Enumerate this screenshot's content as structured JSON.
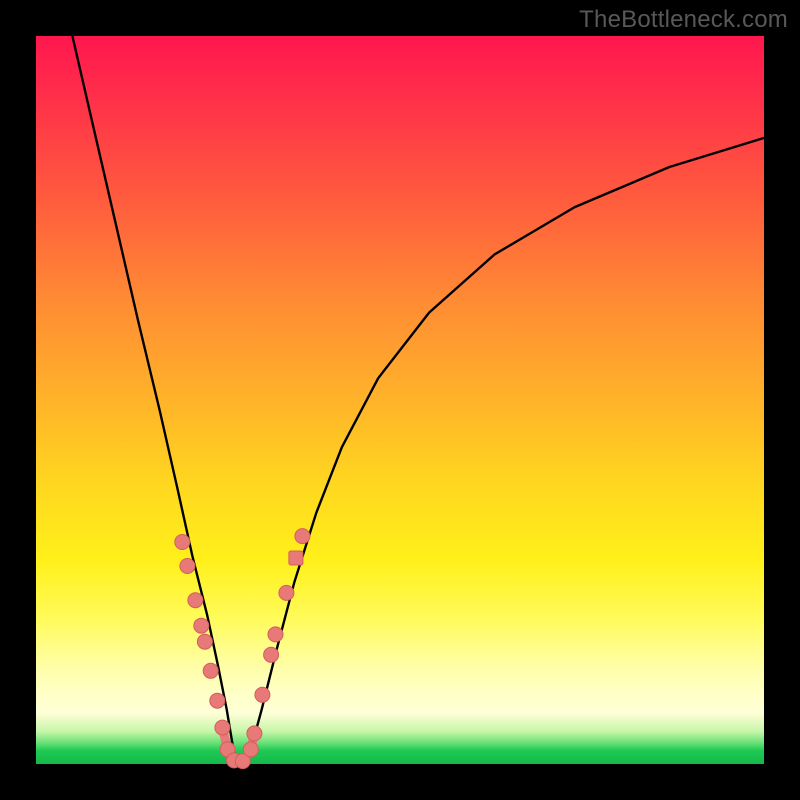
{
  "watermark": "TheBottleneck.com",
  "colors": {
    "dot_fill": "#e77a78",
    "dot_stroke": "#d45d5b",
    "curve": "#000000",
    "frame": "#000000"
  },
  "chart_data": {
    "type": "line",
    "title": "",
    "xlabel": "",
    "ylabel": "",
    "xlim": [
      0,
      1
    ],
    "ylim": [
      0,
      1
    ],
    "series": [
      {
        "name": "bottleneck-curve",
        "note": "V-shaped curve; minimum near x≈0.27, y≈0. Values estimated from pixels (no axis labels present).",
        "x": [
          0.05,
          0.08,
          0.11,
          0.14,
          0.17,
          0.195,
          0.215,
          0.235,
          0.25,
          0.262,
          0.272,
          0.283,
          0.295,
          0.31,
          0.33,
          0.355,
          0.385,
          0.42,
          0.47,
          0.54,
          0.63,
          0.74,
          0.87,
          1.0
        ],
        "y": [
          1.0,
          0.87,
          0.74,
          0.61,
          0.485,
          0.375,
          0.285,
          0.205,
          0.135,
          0.075,
          0.015,
          0.0,
          0.02,
          0.075,
          0.155,
          0.25,
          0.345,
          0.435,
          0.53,
          0.62,
          0.7,
          0.765,
          0.82,
          0.86
        ]
      }
    ],
    "markers": {
      "name": "highlighted-points",
      "note": "Salmon-colored dots near the trough and lower flanks of the V; a few connected by a thick salmon arc at the very bottom.",
      "points": [
        {
          "x": 0.201,
          "y": 0.305
        },
        {
          "x": 0.208,
          "y": 0.272
        },
        {
          "x": 0.219,
          "y": 0.225
        },
        {
          "x": 0.227,
          "y": 0.19
        },
        {
          "x": 0.232,
          "y": 0.168
        },
        {
          "x": 0.24,
          "y": 0.128
        },
        {
          "x": 0.249,
          "y": 0.087
        },
        {
          "x": 0.256,
          "y": 0.05
        },
        {
          "x": 0.263,
          "y": 0.02
        },
        {
          "x": 0.272,
          "y": 0.005
        },
        {
          "x": 0.284,
          "y": 0.004
        },
        {
          "x": 0.295,
          "y": 0.02
        },
        {
          "x": 0.3,
          "y": 0.042
        },
        {
          "x": 0.311,
          "y": 0.095
        },
        {
          "x": 0.323,
          "y": 0.15
        },
        {
          "x": 0.329,
          "y": 0.178
        },
        {
          "x": 0.344,
          "y": 0.235
        },
        {
          "x": 0.357,
          "y": 0.283,
          "shape": "square"
        },
        {
          "x": 0.366,
          "y": 0.313
        }
      ],
      "bottom_arc": [
        {
          "x": 0.256,
          "y": 0.05
        },
        {
          "x": 0.263,
          "y": 0.02
        },
        {
          "x": 0.272,
          "y": 0.005
        },
        {
          "x": 0.284,
          "y": 0.004
        },
        {
          "x": 0.295,
          "y": 0.02
        },
        {
          "x": 0.3,
          "y": 0.042
        }
      ]
    }
  }
}
